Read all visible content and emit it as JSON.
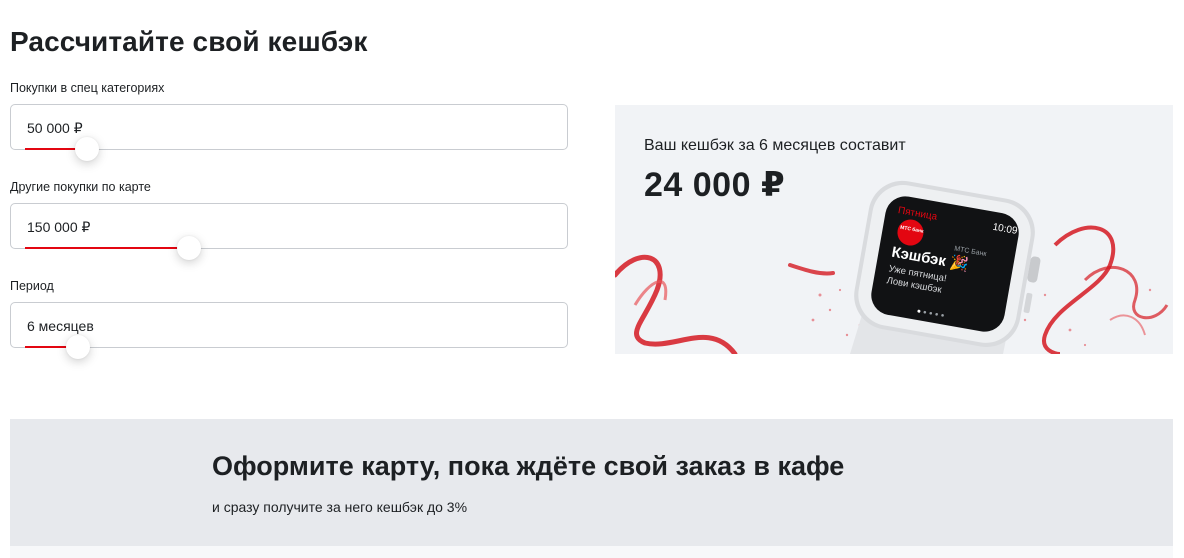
{
  "calculator": {
    "title": "Рассчитайте свой кешбэк",
    "fields": [
      {
        "label": "Покупки в спец категориях",
        "value": "50 000 ₽",
        "slider_position_pct": 11
      },
      {
        "label": "Другие покупки по карте",
        "value": "150 000 ₽",
        "slider_position_pct": 30
      },
      {
        "label": "Период",
        "value": "6 месяцев",
        "slider_position_pct": 9
      }
    ]
  },
  "result": {
    "text": "Ваш кешбэк за 6 месяцев составит",
    "amount": "24 000 ₽"
  },
  "watch": {
    "day": "Пятница",
    "time": "10:09",
    "bank_logo": "МТС банк",
    "bank": "МТС Банк",
    "headline": "Кэшбэк",
    "line1": "Уже пятница!",
    "line2": "Лови кэшбэк"
  },
  "banner": {
    "title": "Оформите карту, пока ждёте свой заказ в кафе",
    "subtitle": "и сразу получите за него кешбэк до 3%"
  },
  "colors": {
    "accent": "#e30611",
    "promo_bg": "#f1f3f6",
    "banner_bg": "#e7e9ed"
  }
}
